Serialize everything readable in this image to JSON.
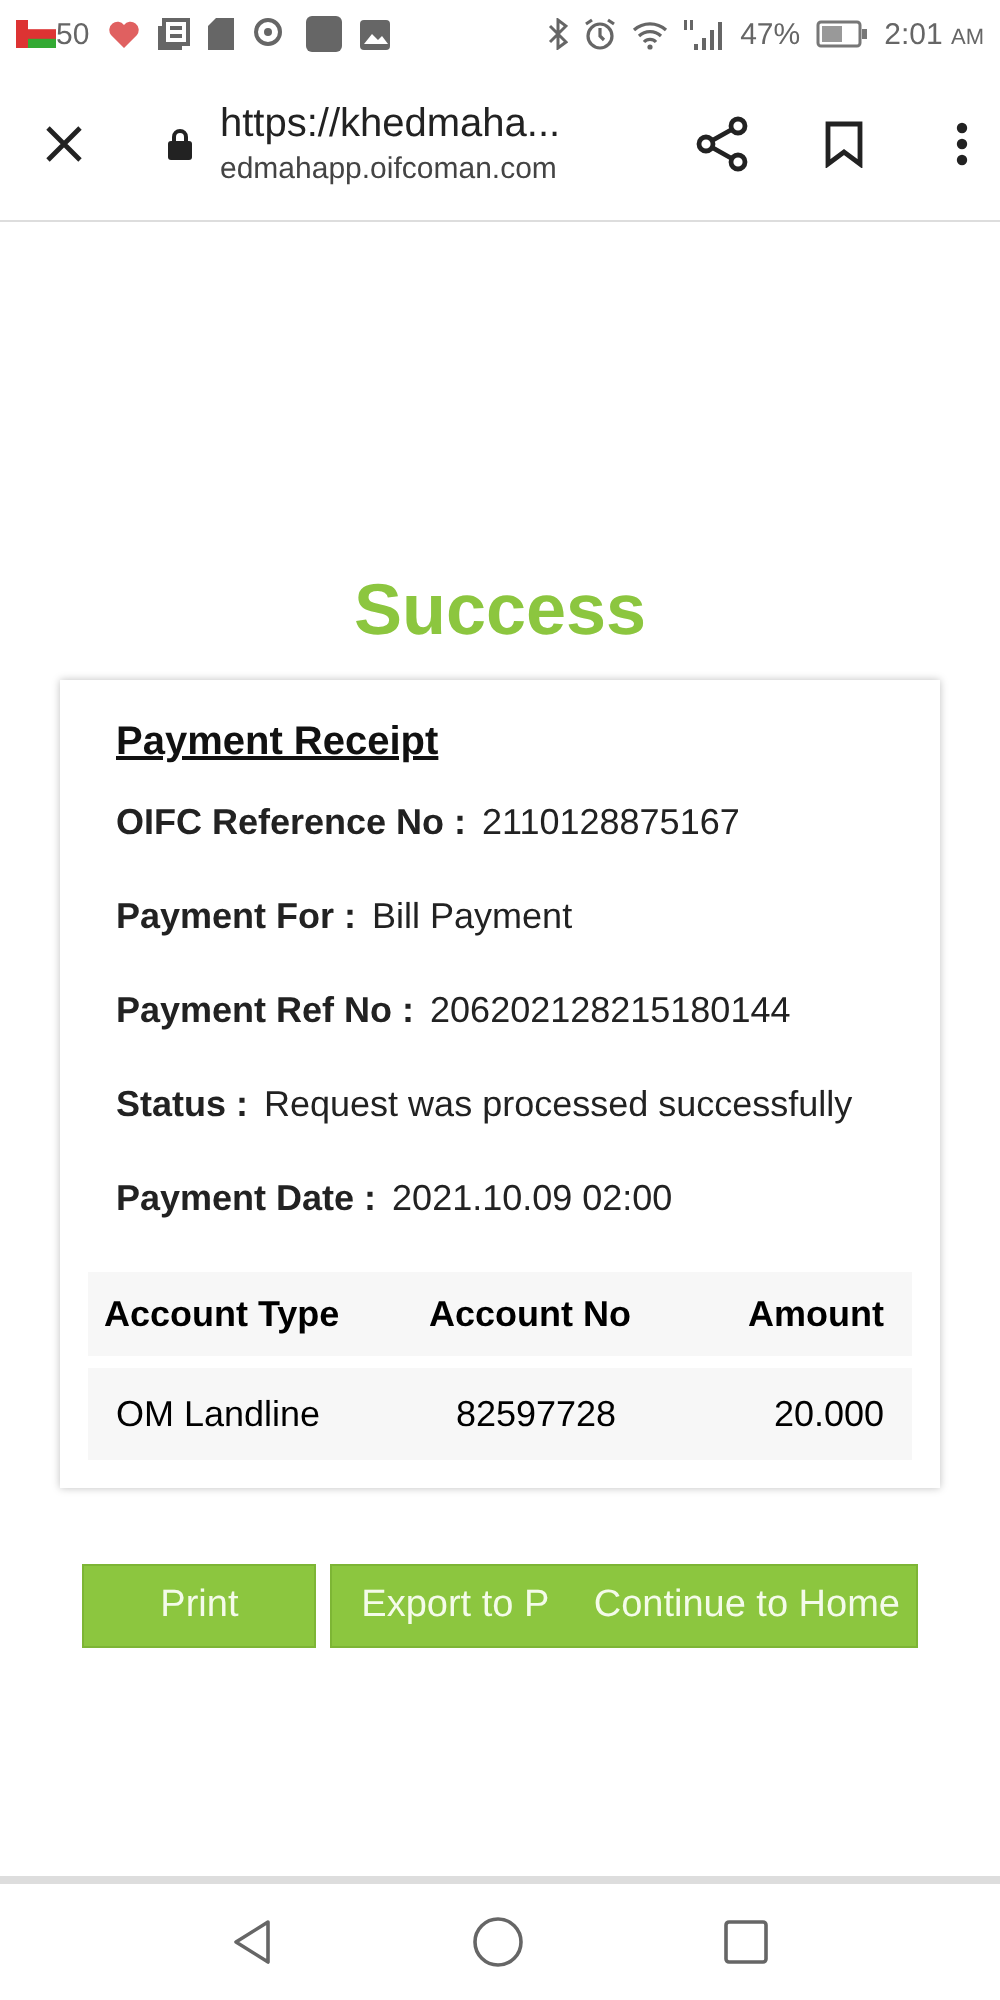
{
  "status_bar": {
    "signal_count": "50",
    "battery": "47%",
    "time": "2:01",
    "time_suffix": "AM"
  },
  "browser": {
    "url": "https://khedmaha...",
    "domain": "edmahapp.oifcoman.com"
  },
  "heading": "Success",
  "receipt": {
    "title": "Payment Receipt",
    "fields": [
      {
        "label": "OIFC Reference No :",
        "value": "2110128875167"
      },
      {
        "label": "Payment For :",
        "value": "Bill Payment"
      },
      {
        "label": "Payment Ref No :",
        "value": "206202128215180144"
      },
      {
        "label": "Status :",
        "value": "Request was processed successfully"
      },
      {
        "label": "Payment Date :",
        "value": "2021.10.09 02:00"
      }
    ],
    "table": {
      "columns": [
        "Account Type",
        "Account No",
        "Amount"
      ],
      "rows": [
        [
          "OM Landline",
          "82597728",
          "20.000"
        ]
      ]
    }
  },
  "buttons": [
    "Print",
    "Export to P",
    "Continue to Home"
  ]
}
